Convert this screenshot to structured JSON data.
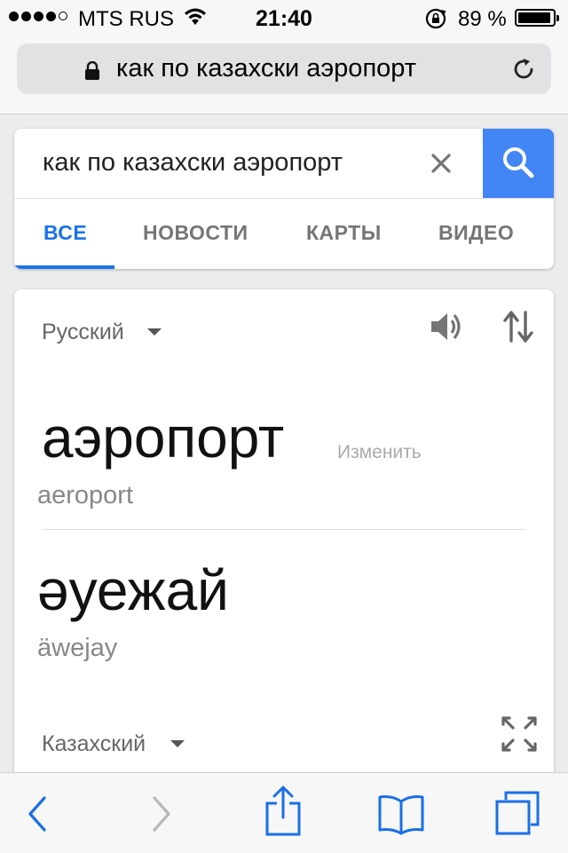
{
  "status_bar": {
    "carrier": "MTS RUS",
    "time": "21:40",
    "battery_percent": "89 %",
    "battery_level": 0.89
  },
  "browser": {
    "url_text": "как по казахски аэропорт"
  },
  "search": {
    "query": "как по казахски аэропорт",
    "tabs": [
      {
        "label": "ВСЕ",
        "active": true
      },
      {
        "label": "НОВОСТИ",
        "active": false
      },
      {
        "label": "КАРТЫ",
        "active": false
      },
      {
        "label": "ВИДЕО",
        "active": false
      }
    ]
  },
  "translate": {
    "source_language": "Русский",
    "source_word": "аэропорт",
    "edit_label": "Изменить",
    "source_transliteration": "aeroport",
    "target_word": "әуежай",
    "target_transliteration": "äwejay",
    "target_language": "Казахский"
  },
  "colors": {
    "accent": "#1a73e8",
    "search_button": "#4285f4"
  },
  "icons": {
    "signal": "signal-dots-icon",
    "wifi": "wifi-icon",
    "rotation_lock": "rotation-lock-icon",
    "battery": "battery-icon",
    "secure": "lock-icon",
    "reload": "reload-icon",
    "clear": "close-icon",
    "search": "search-icon",
    "speaker": "speaker-icon",
    "swap": "swap-icon",
    "expand": "expand-icon",
    "back": "chevron-left-icon",
    "forward": "chevron-right-icon",
    "share": "share-icon",
    "bookmarks": "book-icon",
    "tabs": "tabs-icon"
  }
}
